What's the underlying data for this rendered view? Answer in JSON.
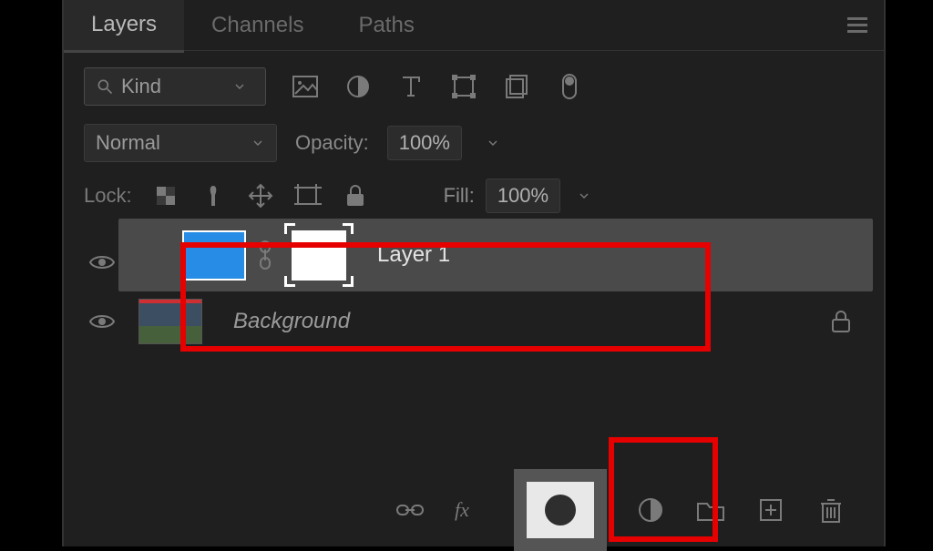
{
  "tabs": {
    "layers": "Layers",
    "channels": "Channels",
    "paths": "Paths"
  },
  "filter": {
    "kind_label": "Kind"
  },
  "blend": {
    "mode": "Normal",
    "opacity_label": "Opacity:",
    "opacity_value": "100%"
  },
  "lock": {
    "label": "Lock:",
    "fill_label": "Fill:",
    "fill_value": "100%"
  },
  "layers": {
    "layer1": {
      "name": "Layer 1"
    },
    "background": {
      "name": "Background"
    }
  }
}
